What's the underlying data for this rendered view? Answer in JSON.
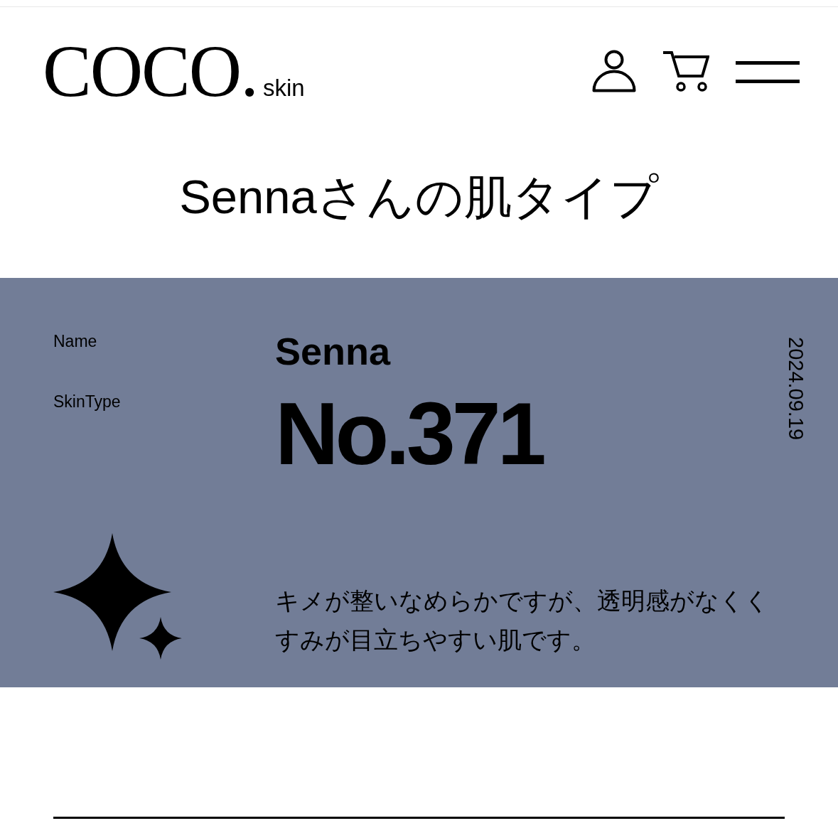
{
  "header": {
    "logo": {
      "wordmark": "COCO.",
      "suffix": "skin"
    }
  },
  "page_title": "Sennaさんの肌タイプ",
  "card": {
    "labels": [
      "Name",
      "SkinType"
    ],
    "name": "Senna",
    "skin_type": "No.371",
    "date": "2024.09.19",
    "description": "キメが整いなめらかですが、透明感がなくくすみが目立ちやすい肌です。"
  }
}
